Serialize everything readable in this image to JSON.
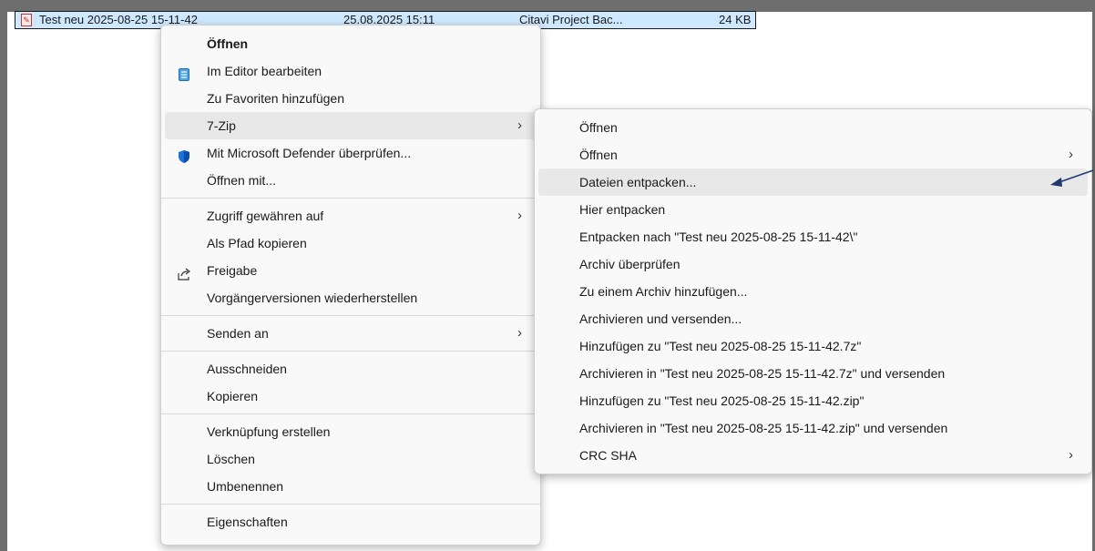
{
  "file": {
    "name": "Test neu 2025-08-25 15-11-42",
    "date": "25.08.2025 15:11",
    "type": "Citavi Project Bac...",
    "size": "24 KB"
  },
  "context_menu": {
    "groups": [
      [
        {
          "label": "Öffnen",
          "bold": true
        },
        {
          "label": "Im Editor bearbeiten",
          "icon": "notepad-icon"
        },
        {
          "label": "Zu Favoriten hinzufügen"
        },
        {
          "label": "7-Zip",
          "submenu": true,
          "highlighted": true
        },
        {
          "label": "Mit Microsoft Defender überprüfen...",
          "icon": "defender-shield-icon"
        },
        {
          "label": "Öffnen mit..."
        }
      ],
      [
        {
          "label": "Zugriff gewähren auf",
          "submenu": true
        },
        {
          "label": "Als Pfad kopieren"
        },
        {
          "label": "Freigabe",
          "icon": "share-icon"
        },
        {
          "label": "Vorgängerversionen wiederherstellen"
        }
      ],
      [
        {
          "label": "Senden an",
          "submenu": true
        }
      ],
      [
        {
          "label": "Ausschneiden"
        },
        {
          "label": "Kopieren"
        }
      ],
      [
        {
          "label": "Verknüpfung erstellen"
        },
        {
          "label": "Löschen"
        },
        {
          "label": "Umbenennen"
        }
      ],
      [
        {
          "label": "Eigenschaften"
        }
      ]
    ]
  },
  "sevenzip_menu": {
    "items": [
      {
        "label": "Öffnen"
      },
      {
        "label": "Öffnen",
        "submenu": true
      },
      {
        "label": "Dateien entpacken...",
        "highlighted": true
      },
      {
        "label": "Hier entpacken"
      },
      {
        "label": "Entpacken nach \"Test neu 2025-08-25 15-11-42\\\""
      },
      {
        "label": "Archiv überprüfen"
      },
      {
        "label": "Zu einem Archiv hinzufügen..."
      },
      {
        "label": "Archivieren und versenden..."
      },
      {
        "label": "Hinzufügen zu \"Test neu 2025-08-25 15-11-42.7z\""
      },
      {
        "label": "Archivieren in \"Test neu 2025-08-25 15-11-42.7z\" und versenden"
      },
      {
        "label": "Hinzufügen zu \"Test neu 2025-08-25 15-11-42.zip\""
      },
      {
        "label": "Archivieren in \"Test neu 2025-08-25 15-11-42.zip\" und versenden"
      },
      {
        "label": "CRC SHA",
        "submenu": true
      }
    ]
  },
  "colors": {
    "selection": "#cde8ff",
    "highlight": "#e8e8e8",
    "arrow": "#1f3a6e",
    "defender": "#1a73d9"
  }
}
